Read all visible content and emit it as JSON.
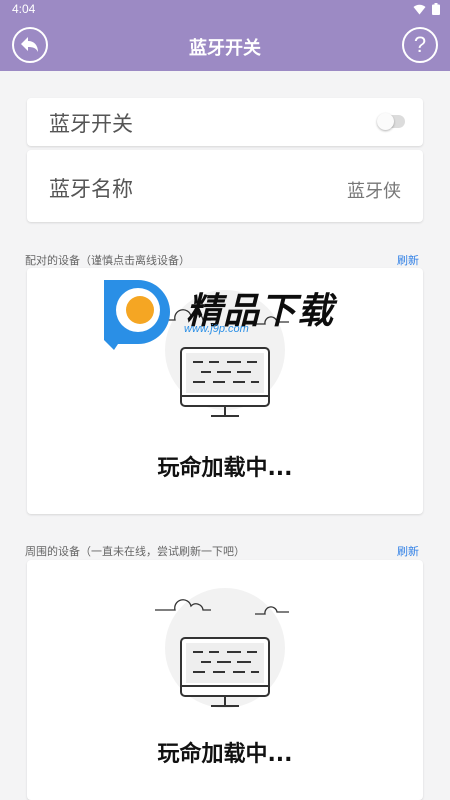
{
  "status_bar": {
    "time": "4:04",
    "icons": [
      "wifi-icon",
      "battery-icon"
    ]
  },
  "app_bar": {
    "title": "蓝牙开关",
    "back_icon": "back-arrow-icon",
    "help_label": "?"
  },
  "bluetooth_switch": {
    "label": "蓝牙开关",
    "enabled": false
  },
  "bluetooth_name": {
    "label": "蓝牙名称",
    "value": "蓝牙侠"
  },
  "paired_section": {
    "caption": "配对的设备（谨慎点击离线设备）",
    "refresh_label": "刷新",
    "loading_text": "玩命加载中..."
  },
  "nearby_section": {
    "caption": "周围的设备（一直未在线，尝试刷新一下吧）",
    "refresh_label": "刷新",
    "loading_text": "玩命加载中..."
  },
  "watermark": {
    "brand": "精品下载",
    "url": "www.j9p.com"
  },
  "colors": {
    "app_bar": "#9c8ac4",
    "accent_link": "#2f7fe6",
    "background": "#f4f4f5"
  }
}
